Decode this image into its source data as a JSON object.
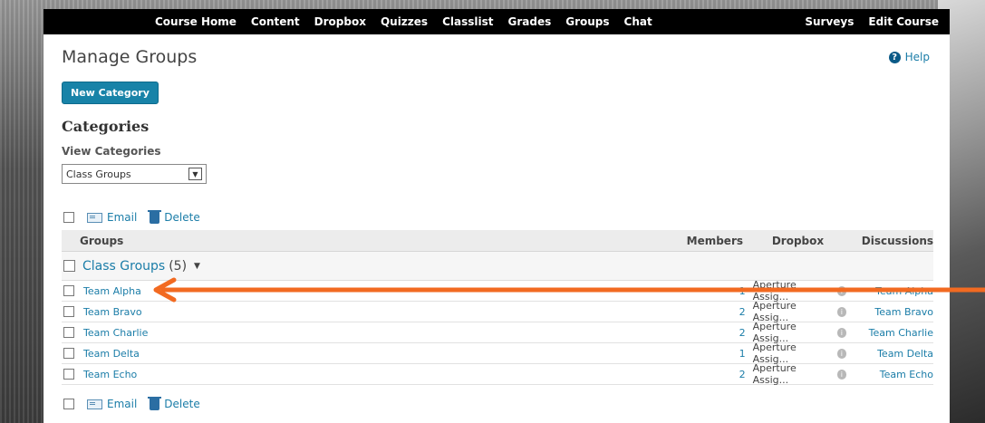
{
  "nav": {
    "left_items": [
      "Course Home",
      "Content",
      "Dropbox",
      "Quizzes",
      "Classlist",
      "Grades",
      "Groups",
      "Chat"
    ],
    "right_items": [
      "Surveys",
      "Edit Course"
    ]
  },
  "page": {
    "title": "Manage Groups",
    "help_label": "Help",
    "new_category_label": "New Category",
    "categories_heading": "Categories",
    "view_categories_label": "View Categories",
    "category_select_value": "Class Groups"
  },
  "actions": {
    "email_label": "Email",
    "delete_label": "Delete"
  },
  "table": {
    "headers": {
      "groups": "Groups",
      "members": "Members",
      "dropbox": "Dropbox",
      "discussions": "Discussions"
    },
    "category": {
      "name": "Class Groups",
      "count": "(5)"
    },
    "rows": [
      {
        "name": "Team Alpha",
        "members": "1",
        "dropbox": "Aperture Assig...",
        "discussion": "Team Alpha"
      },
      {
        "name": "Team Bravo",
        "members": "2",
        "dropbox": "Aperture Assig...",
        "discussion": "Team Bravo"
      },
      {
        "name": "Team Charlie",
        "members": "2",
        "dropbox": "Aperture Assig...",
        "discussion": "Team Charlie"
      },
      {
        "name": "Team Delta",
        "members": "1",
        "dropbox": "Aperture Assig...",
        "discussion": "Team Delta"
      },
      {
        "name": "Team Echo",
        "members": "2",
        "dropbox": "Aperture Assig...",
        "discussion": "Team Echo"
      }
    ]
  },
  "colors": {
    "nav_bg": "#000000",
    "link": "#1b7da8",
    "button": "#1883a8",
    "annotation_arrow": "#f26a21"
  },
  "icons": {
    "email": "mail-icon",
    "delete": "trash-icon",
    "help": "help-circle-icon",
    "info": "info-icon",
    "caret": "caret-down-icon",
    "annotation": "arrow-left-icon"
  }
}
